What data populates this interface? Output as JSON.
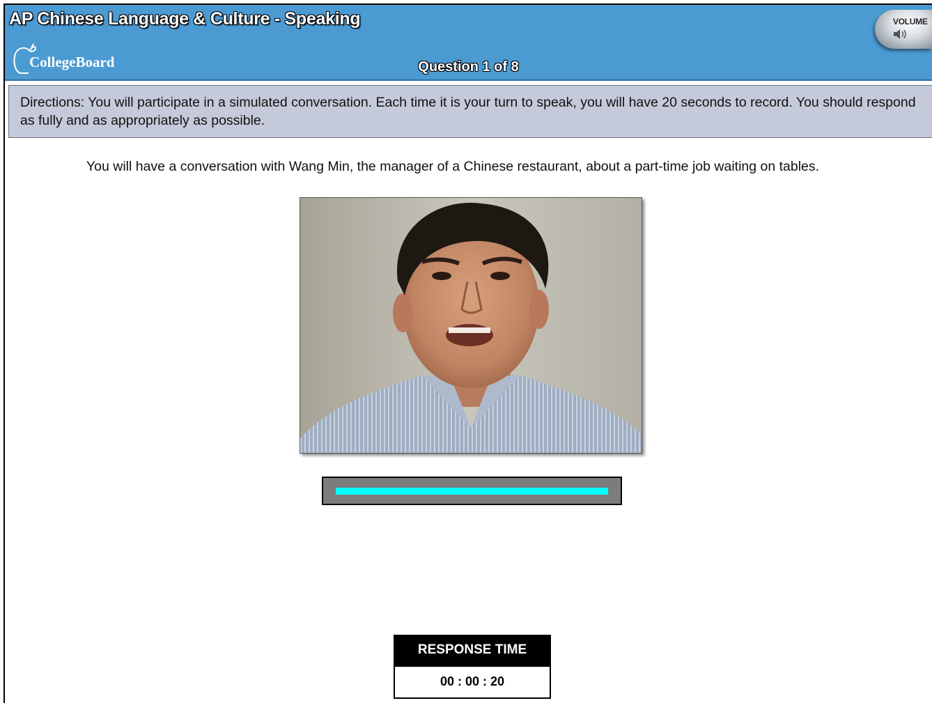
{
  "header": {
    "app_title": "AP Chinese Language & Culture - Speaking",
    "logo_text": "CollegeBoard",
    "question_counter": "Question 1 of 8",
    "volume_label": "VOLUME",
    "colors": {
      "bar": "#4b9ad2"
    }
  },
  "directions": {
    "text": "Directions: You will participate in a simulated conversation. Each time it is your turn to speak, you will have 20 seconds to record. You should respond as fully and as appropriately as possible."
  },
  "scenario": {
    "text": "You will have a conversation with Wang Min, the manager of a Chinese restaurant, about a part-time job waiting on tables."
  },
  "audio_progress": {
    "fraction": 1.0,
    "color": "#00ffff"
  },
  "response": {
    "title": "RESPONSE TIME",
    "time": "00 : 00 : 20"
  }
}
